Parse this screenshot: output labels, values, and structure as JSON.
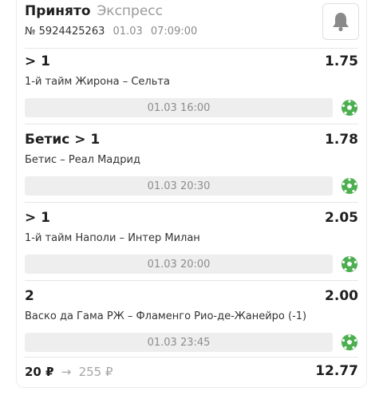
{
  "header": {
    "status": "Принято",
    "bet_type": "Экспресс",
    "bet_number": "№ 5924425263",
    "date": "01.03",
    "time": "07:09:00"
  },
  "bets": [
    {
      "outcome": "> 1",
      "odds": "1.75",
      "match": "1-й тайм Жирона – Сельта",
      "datetime": "01.03 16:00"
    },
    {
      "outcome": "Бетис > 1",
      "odds": "1.78",
      "match": "Бетис – Реал Мадрид",
      "datetime": "01.03 20:30"
    },
    {
      "outcome": "> 1",
      "odds": "2.05",
      "match": "1-й тайм Наполи – Интер Милан",
      "datetime": "01.03 20:00"
    },
    {
      "outcome": "2",
      "odds": "2.00",
      "match": "Васко да Гама РЖ – Фламенго Рио-де-Жанейро (-1)",
      "datetime": "01.03 23:45"
    }
  ],
  "footer": {
    "stake": "20 ₽",
    "arrow": "→",
    "potential_win": "255 ₽",
    "total_odds": "12.77"
  },
  "icons": {
    "bell": "bell-icon",
    "sport": "soccer-ball-icon"
  },
  "colors": {
    "ball": "#4caf50",
    "muted": "#9a9a9a"
  }
}
